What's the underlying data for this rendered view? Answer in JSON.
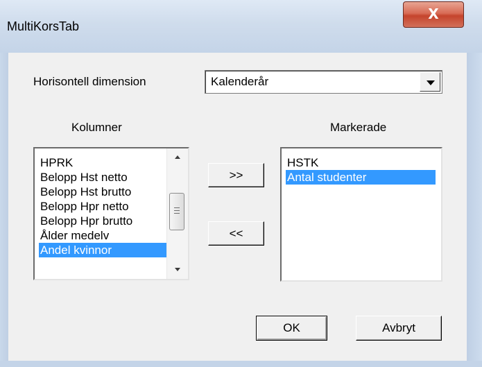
{
  "window": {
    "title": "MultiKorsTab",
    "close_glyph": "X"
  },
  "horizontal": {
    "label": "Horisontell dimension",
    "selected": "Kalenderår"
  },
  "columns": {
    "label": "Kolumner",
    "items": [
      {
        "label": "HPRK",
        "selected": false
      },
      {
        "label": "Belopp Hst netto",
        "selected": false
      },
      {
        "label": "Belopp Hst brutto",
        "selected": false
      },
      {
        "label": "Belopp Hpr netto",
        "selected": false
      },
      {
        "label": "Belopp Hpr brutto",
        "selected": false
      },
      {
        "label": "Ålder medelv",
        "selected": false
      },
      {
        "label": "Andel kvinnor",
        "selected": true
      }
    ]
  },
  "marked": {
    "label": "Markerade",
    "items": [
      {
        "label": "HSTK",
        "selected": false
      },
      {
        "label": "Antal studenter",
        "selected": true
      }
    ]
  },
  "buttons": {
    "add": ">>",
    "remove": "<<",
    "ok": "OK",
    "cancel": "Avbryt"
  },
  "colors": {
    "selection": "#3399ff",
    "dialog_bg": "#f0f0f0"
  }
}
